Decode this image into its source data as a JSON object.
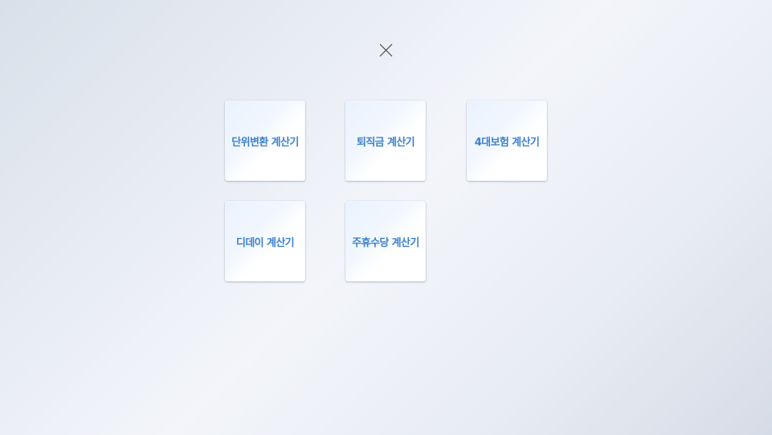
{
  "close_button": {
    "icon": "close-icon",
    "color": "#4a4a4a"
  },
  "menu": {
    "items": [
      {
        "label": "단위변환 계산기"
      },
      {
        "label": "퇴직금 계산기"
      },
      {
        "label": "4대보험 계산기"
      },
      {
        "label": "디데이 계산기"
      },
      {
        "label": "주휴수당 계산기"
      }
    ]
  },
  "colors": {
    "label_text": "#3d82cf",
    "card_background": "#ffffff",
    "page_background": "#e8ecf3"
  }
}
